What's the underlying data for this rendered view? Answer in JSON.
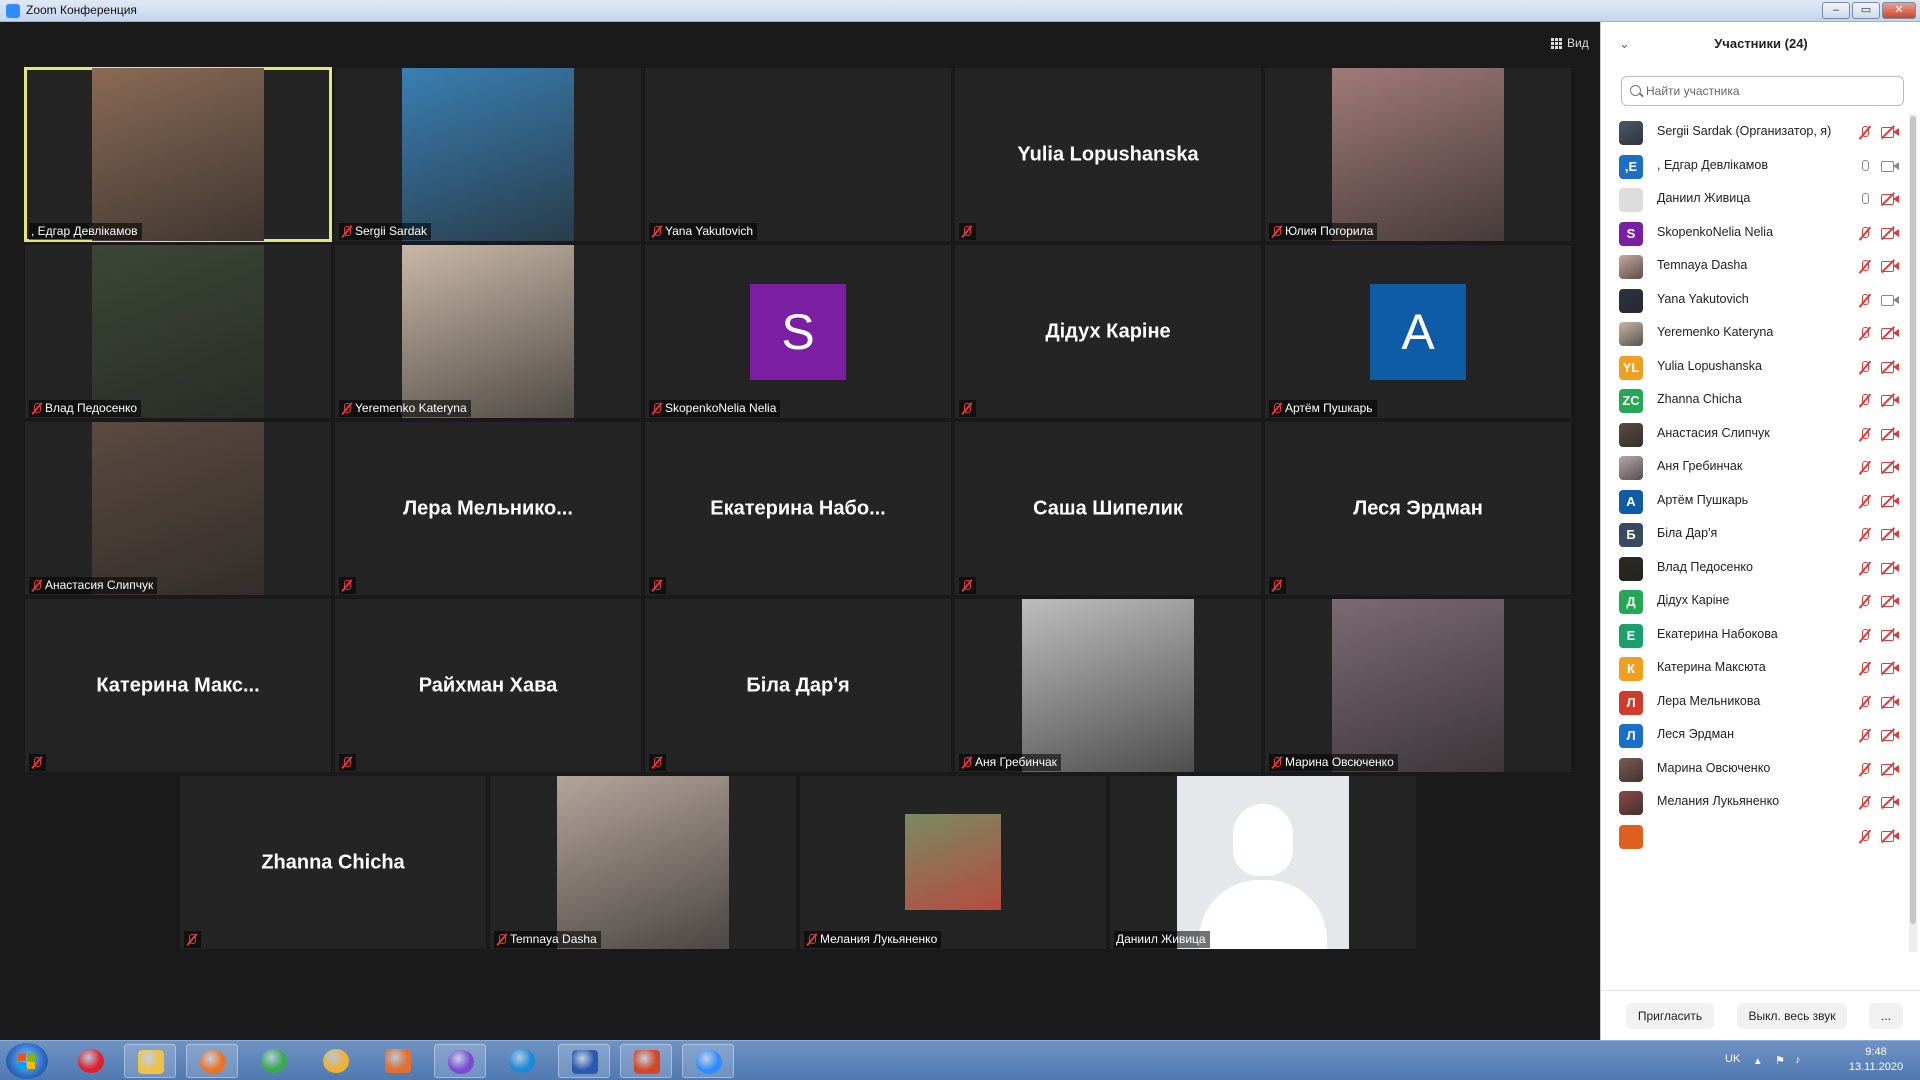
{
  "window": {
    "title": "Zoom Конференция",
    "min": "–",
    "max": "▭",
    "close": "✕"
  },
  "toolbar": {
    "view_label": "Вид"
  },
  "tiles": [
    {
      "name": ", Едгар Девлікамов",
      "type": "photo",
      "bg": "#8a6a55",
      "active": true,
      "muted": false
    },
    {
      "name": "Sergii Sardak",
      "type": "photo",
      "bg": "#3a7fb2",
      "muted": true
    },
    {
      "name": "Yana Yakutovich",
      "type": "empty",
      "muted": true
    },
    {
      "name": "",
      "big": "Yulia Lopushanska",
      "type": "text",
      "muted": true
    },
    {
      "name": "Юлия Погорила",
      "type": "photo",
      "bg": "#a07a78",
      "muted": true
    },
    {
      "name": "Влад Педосенко",
      "type": "photo",
      "bg": "#3c4636",
      "muted": true
    },
    {
      "name": "Yeremenko Kateryna",
      "type": "photo",
      "bg": "#c8b7a6",
      "muted": true
    },
    {
      "name": "SkopenkoNelia Nelia",
      "type": "avatar",
      "letter": "S",
      "color": "#7a1fa2",
      "muted": true
    },
    {
      "name": "",
      "big": "Дідух Каріне",
      "type": "text",
      "muted": true
    },
    {
      "name": "Артём Пушкарь",
      "type": "avatar",
      "letter": "A",
      "color": "#0e5ba6",
      "muted": true
    },
    {
      "name": "Анастасия Слипчук",
      "type": "photo",
      "bg": "#5b4a40",
      "muted": true
    },
    {
      "name": "",
      "big": "Лера  Мельнико...",
      "type": "text",
      "muted": true
    },
    {
      "name": "",
      "big": "Екатерина  Набо...",
      "type": "text",
      "muted": true
    },
    {
      "name": "",
      "big": "Саша Шипелик",
      "type": "text",
      "muted": true
    },
    {
      "name": "",
      "big": "Леся Эрдман",
      "type": "text",
      "muted": true
    },
    {
      "name": "",
      "big": "Катерина  Макс...",
      "type": "text",
      "muted": true
    },
    {
      "name": "",
      "big": "Райхман Хава",
      "type": "text",
      "muted": true
    },
    {
      "name": "",
      "big": "Біла Дар'я",
      "type": "text",
      "muted": true
    },
    {
      "name": "Аня Гребинчак",
      "type": "photo",
      "bg": "#bdbdbd",
      "muted": true
    },
    {
      "name": "Марина Овсюченко",
      "type": "photo",
      "bg": "#7b6a72",
      "muted": true
    },
    {
      "name": "",
      "big": "Zhanna Chicha",
      "type": "text",
      "muted": true
    },
    {
      "name": "Temnaya Dasha",
      "type": "photo",
      "bg": "#b3a49a",
      "muted": true
    },
    {
      "name": "Мелания Лукьяненко",
      "type": "smallphoto",
      "bg": "#7a8a62",
      "muted": true
    },
    {
      "name": "Даниил Живица",
      "type": "silhouette",
      "muted": false
    }
  ],
  "panel": {
    "title": "Участники (24)",
    "collapse_icon": "⌄",
    "search_placeholder": "Найти участника",
    "participants": [
      {
        "name": "Sergii Sardak (Организатор, я)",
        "av": "photo",
        "color": "#4a5a6a",
        "mic": "off",
        "video": "off"
      },
      {
        "name": ", Едгар Девлікамов",
        "av": "letter",
        "letter": ",Е",
        "color": "#1a6fc9",
        "mic": "on",
        "video": "on"
      },
      {
        "name": "Даниил Живица",
        "av": "letter",
        "letter": "",
        "color": "#dddddd",
        "mic": "on",
        "video": "off"
      },
      {
        "name": "SkopenkoNelia Nelia",
        "av": "letter",
        "letter": "S",
        "color": "#7a1fa2",
        "mic": "off",
        "video": "off"
      },
      {
        "name": "Temnaya Dasha",
        "av": "photo",
        "color": "#c9a8a0",
        "mic": "off",
        "video": "off"
      },
      {
        "name": "Yana Yakutovich",
        "av": "photo",
        "color": "#2d3440",
        "mic": "off",
        "video": "on"
      },
      {
        "name": "Yeremenko Kateryna",
        "av": "photo",
        "color": "#c8b7a6",
        "mic": "off",
        "video": "off"
      },
      {
        "name": "Yulia Lopushanska",
        "av": "letter",
        "letter": "YL",
        "color": "#f0a020",
        "mic": "off",
        "video": "off"
      },
      {
        "name": "Zhanna Chicha",
        "av": "letter",
        "letter": "ZC",
        "color": "#25a855",
        "mic": "off",
        "video": "off"
      },
      {
        "name": "Анастасия Слипчук",
        "av": "photo",
        "color": "#5b4a40",
        "mic": "off",
        "video": "off"
      },
      {
        "name": "Аня Гребинчак",
        "av": "photo",
        "color": "#b8a8a8",
        "mic": "off",
        "video": "off"
      },
      {
        "name": "Артём Пушкарь",
        "av": "letter",
        "letter": "A",
        "color": "#0e5ba6",
        "mic": "off",
        "video": "off"
      },
      {
        "name": "Біла Дар'я",
        "av": "letter",
        "letter": "Б",
        "color": "#3a4a5e",
        "mic": "off",
        "video": "off"
      },
      {
        "name": "Влад Педосенко",
        "av": "photo",
        "color": "#2a2a20",
        "mic": "off",
        "video": "off"
      },
      {
        "name": "Дідух Каріне",
        "av": "letter",
        "letter": "Д",
        "color": "#25a855",
        "mic": "off",
        "video": "off"
      },
      {
        "name": "Екатерина Набокова",
        "av": "letter",
        "letter": "Е",
        "color": "#1ba06c",
        "mic": "off",
        "video": "off"
      },
      {
        "name": "Катерина Максюта",
        "av": "letter",
        "letter": "К",
        "color": "#f0a020",
        "mic": "off",
        "video": "off"
      },
      {
        "name": "Лера Мельникова",
        "av": "letter",
        "letter": "Л",
        "color": "#d23a2a",
        "mic": "off",
        "video": "off"
      },
      {
        "name": "Леся Эрдман",
        "av": "letter",
        "letter": "Л",
        "color": "#1a6fc9",
        "mic": "off",
        "video": "off"
      },
      {
        "name": "Марина Овсюченко",
        "av": "photo",
        "color": "#7b5a52",
        "mic": "off",
        "video": "off"
      },
      {
        "name": "Мелания Лукьяненко",
        "av": "photo",
        "color": "#8a4a4a",
        "mic": "off",
        "video": "off"
      },
      {
        "name": "",
        "av": "letter",
        "letter": "",
        "color": "#e06020",
        "mic": "off",
        "video": "off"
      }
    ],
    "invite_label": "Пригласить",
    "mute_all_label": "Выкл. весь звук",
    "more_label": "..."
  },
  "taskbar": {
    "apps": [
      {
        "name": "opera",
        "color": "#e0202a",
        "open": false
      },
      {
        "name": "explorer",
        "color": "#f0c040",
        "open": true
      },
      {
        "name": "firefox",
        "color": "#f07020",
        "open": true
      },
      {
        "name": "chrome",
        "color": "#3aa850",
        "open": false
      },
      {
        "name": "tor",
        "color": "#f0b030",
        "open": false
      },
      {
        "name": "media-player",
        "color": "#e07030",
        "open": false
      },
      {
        "name": "viber",
        "color": "#7a4ad0",
        "open": true
      },
      {
        "name": "edge",
        "color": "#1a8ad8",
        "open": false
      },
      {
        "name": "word",
        "color": "#2a5ab0",
        "open": true
      },
      {
        "name": "powerpoint",
        "color": "#d24726",
        "open": true
      },
      {
        "name": "zoom",
        "color": "#2d8cff",
        "open": true
      }
    ],
    "lang": "UK",
    "time": "9:48",
    "date": "13.11.2020"
  }
}
